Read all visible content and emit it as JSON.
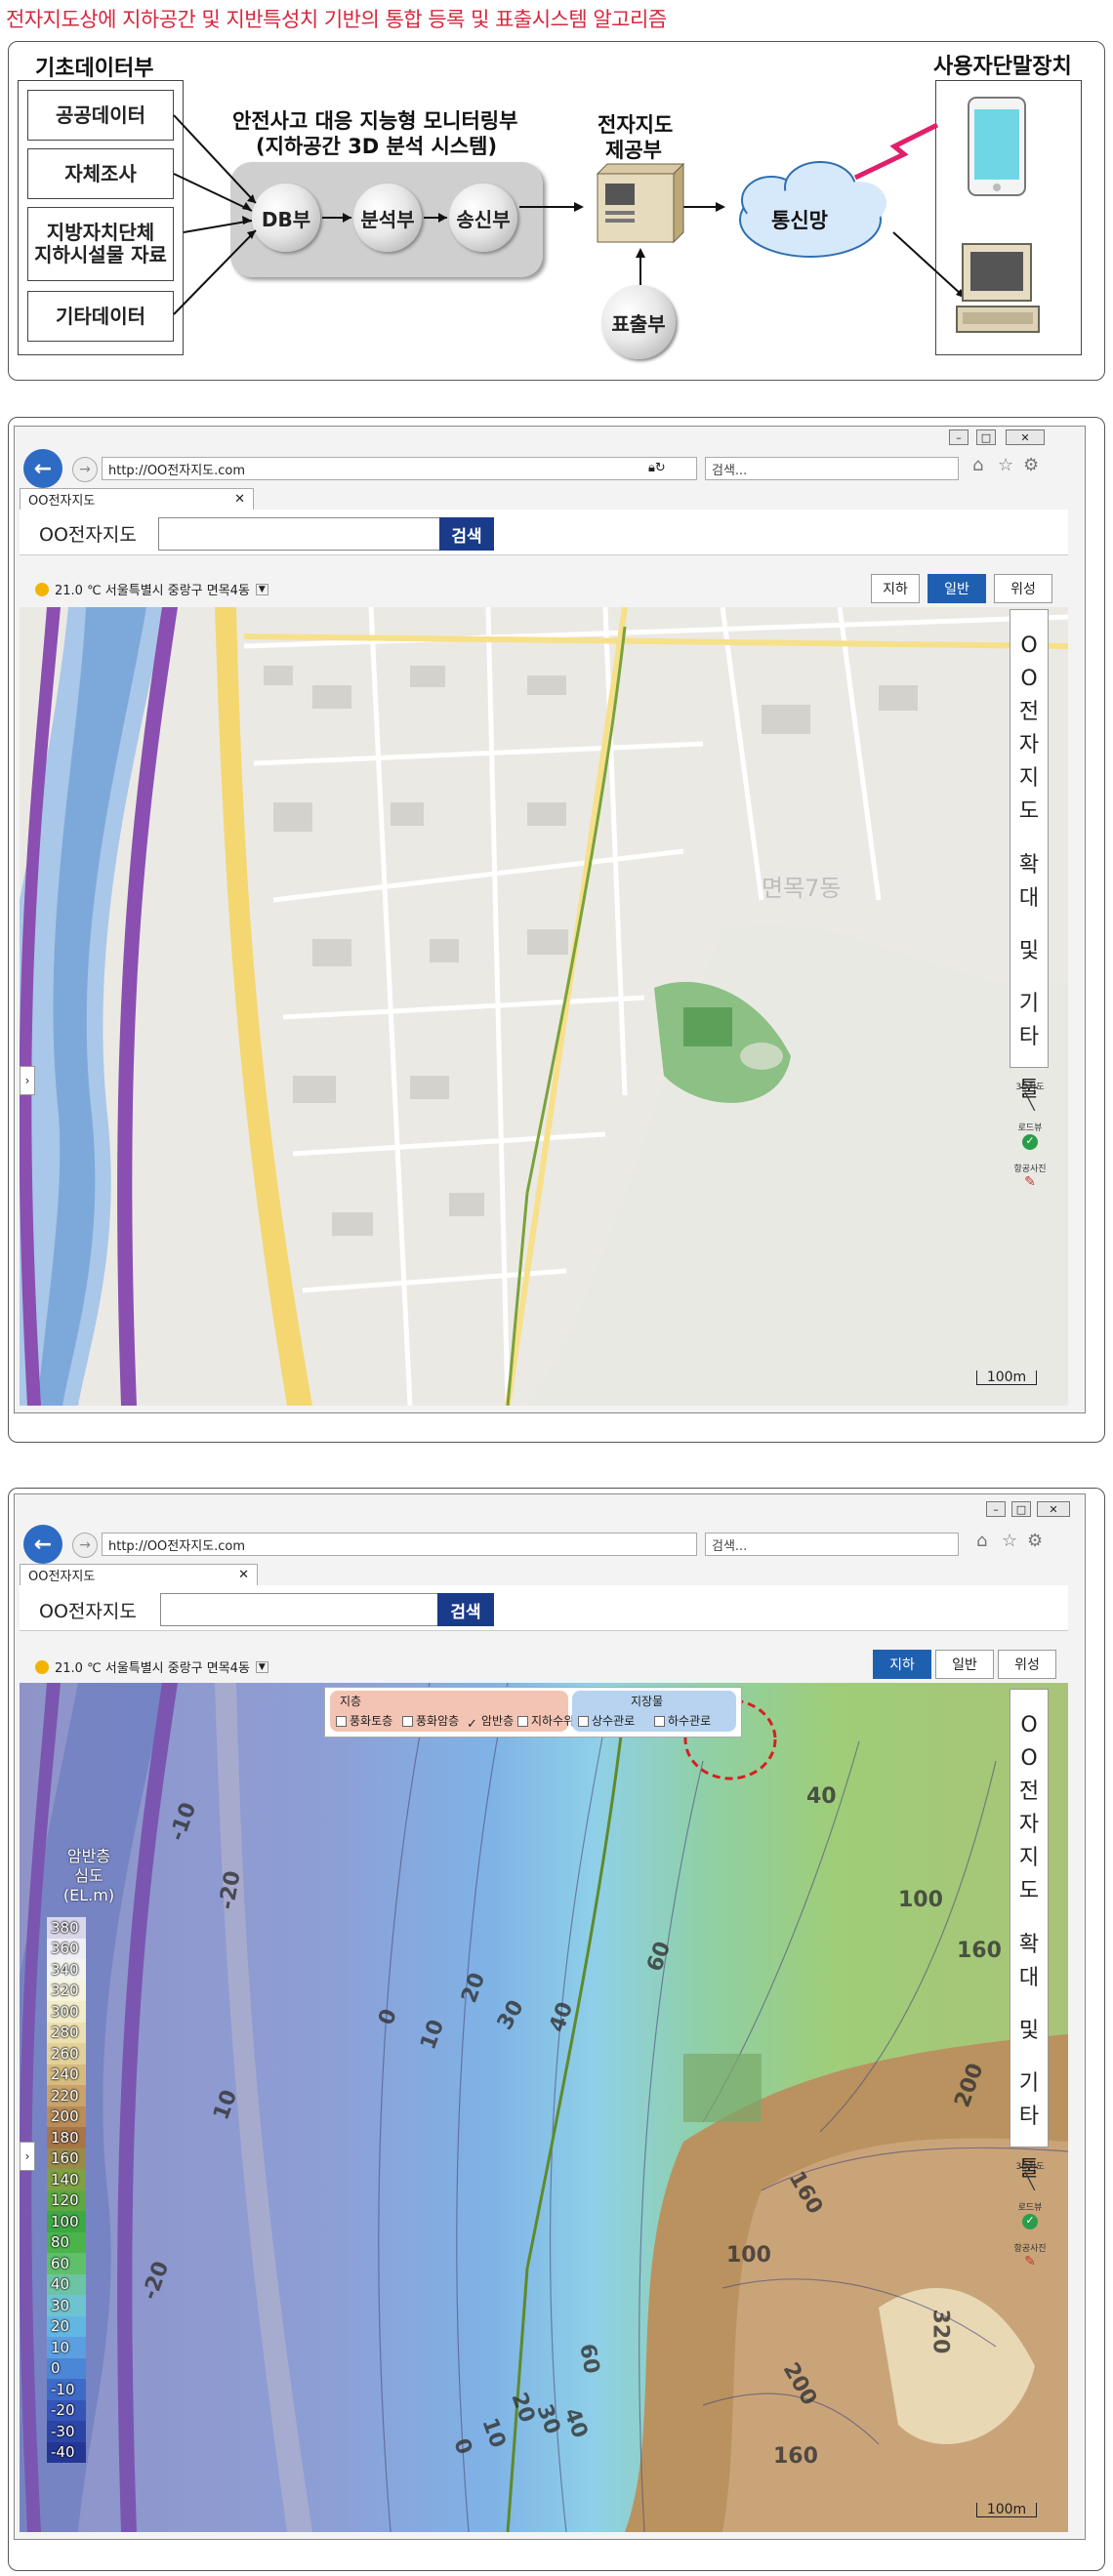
{
  "page_title": "전자지도상에 지하공간 및 지반특성치 기반의 통합 등록 및 표출시스템 알고리즘",
  "diagram": {
    "basic_data_title": "기초데이터부",
    "sources": [
      "공공데이터",
      "자체조사",
      "지방자치단체\n지하시설물 자료",
      "기타데이터"
    ],
    "monitoring_title_line1": "안전사고 대응 지능형 모니터링부",
    "monitoring_title_line2": "(지하공간 3D 분석 시스템)",
    "db": "DB부",
    "analysis": "분석부",
    "transmit": "송신부",
    "emap_provider_line1": "전자지도",
    "emap_provider_line2": "제공부",
    "display": "표출부",
    "network": "통신망",
    "user_device_title": "사용자단말장치"
  },
  "browser1": {
    "url": "http://OO전자지도.com",
    "search_placeholder": "검색...",
    "tab_label": "OO전자지도",
    "brand": "OO전자지도",
    "search_button": "검색",
    "weather": "21.0 ℃ 서울특별시 중랑구 면목4동",
    "modes": [
      "지하",
      "일반",
      "위성"
    ],
    "active_mode": "일반",
    "side_tool_chars": [
      "O",
      "O",
      "전",
      "자",
      "지",
      "도",
      "확",
      "대",
      "및",
      "기",
      "타",
      "툴"
    ],
    "tools": [
      "3D지도",
      "로드뷰",
      "항공사진"
    ],
    "map_district": "면목7동",
    "scale": "100m"
  },
  "browser2": {
    "url": "http://OO전자지도.com",
    "search_placeholder": "검색...",
    "tab_label": "OO전자지도",
    "brand": "OO전자지도",
    "search_button": "검색",
    "weather": "21.0 ℃ 서울특별시 중랑구 면목4동",
    "modes": [
      "지하",
      "일반",
      "위성"
    ],
    "active_mode": "지하",
    "layers": {
      "strata_title": "지층",
      "strata_items": [
        "풍화토층",
        "풍화암층",
        "암반층",
        "지하수위"
      ],
      "strata_checked": "암반층",
      "facility_title": "지장물",
      "facility_items": [
        "상수관로",
        "하수관로"
      ]
    },
    "legend": {
      "title_line1": "암반층",
      "title_line2": "심도",
      "title_line3": "(EL.m)",
      "levels": [
        "380",
        "360",
        "340",
        "320",
        "300",
        "280",
        "260",
        "240",
        "220",
        "200",
        "180",
        "160",
        "140",
        "120",
        "100",
        "80",
        "60",
        "40",
        "30",
        "20",
        "10",
        "0",
        "-10",
        "-20",
        "-30",
        "-40"
      ],
      "colors": [
        "#d9d6ea",
        "#efeef6",
        "#f4f4ee",
        "#f6f4dc",
        "#f2ecc8",
        "#ece0b0",
        "#e3d19a",
        "#d6bb7f",
        "#c9a36c",
        "#ba8c58",
        "#a87547",
        "#9a8a4a",
        "#7fa043",
        "#5fa840",
        "#3ea843",
        "#4ab34a",
        "#5fbf6b",
        "#6cc4a4",
        "#6dc4d0",
        "#62b6e2",
        "#5c9fe0",
        "#4c86d6",
        "#3e6bc8",
        "#3556b8",
        "#2c45a4",
        "#243694"
      ]
    },
    "contour_labels": [
      "-10",
      "-20",
      "-20",
      "20",
      "30",
      "10",
      "0",
      "10",
      "-10",
      "40",
      "60",
      "40",
      "100",
      "160",
      "200",
      "160",
      "100",
      "320",
      "200",
      "160",
      "60",
      "20",
      "30",
      "40",
      "10",
      "0",
      "-20"
    ],
    "side_tool_chars": [
      "O",
      "O",
      "전",
      "자",
      "지",
      "도",
      "확",
      "대",
      "및",
      "기",
      "타",
      "툴"
    ],
    "tools": [
      "3D지도",
      "로드뷰",
      "항공사진"
    ],
    "scale": "100m"
  }
}
